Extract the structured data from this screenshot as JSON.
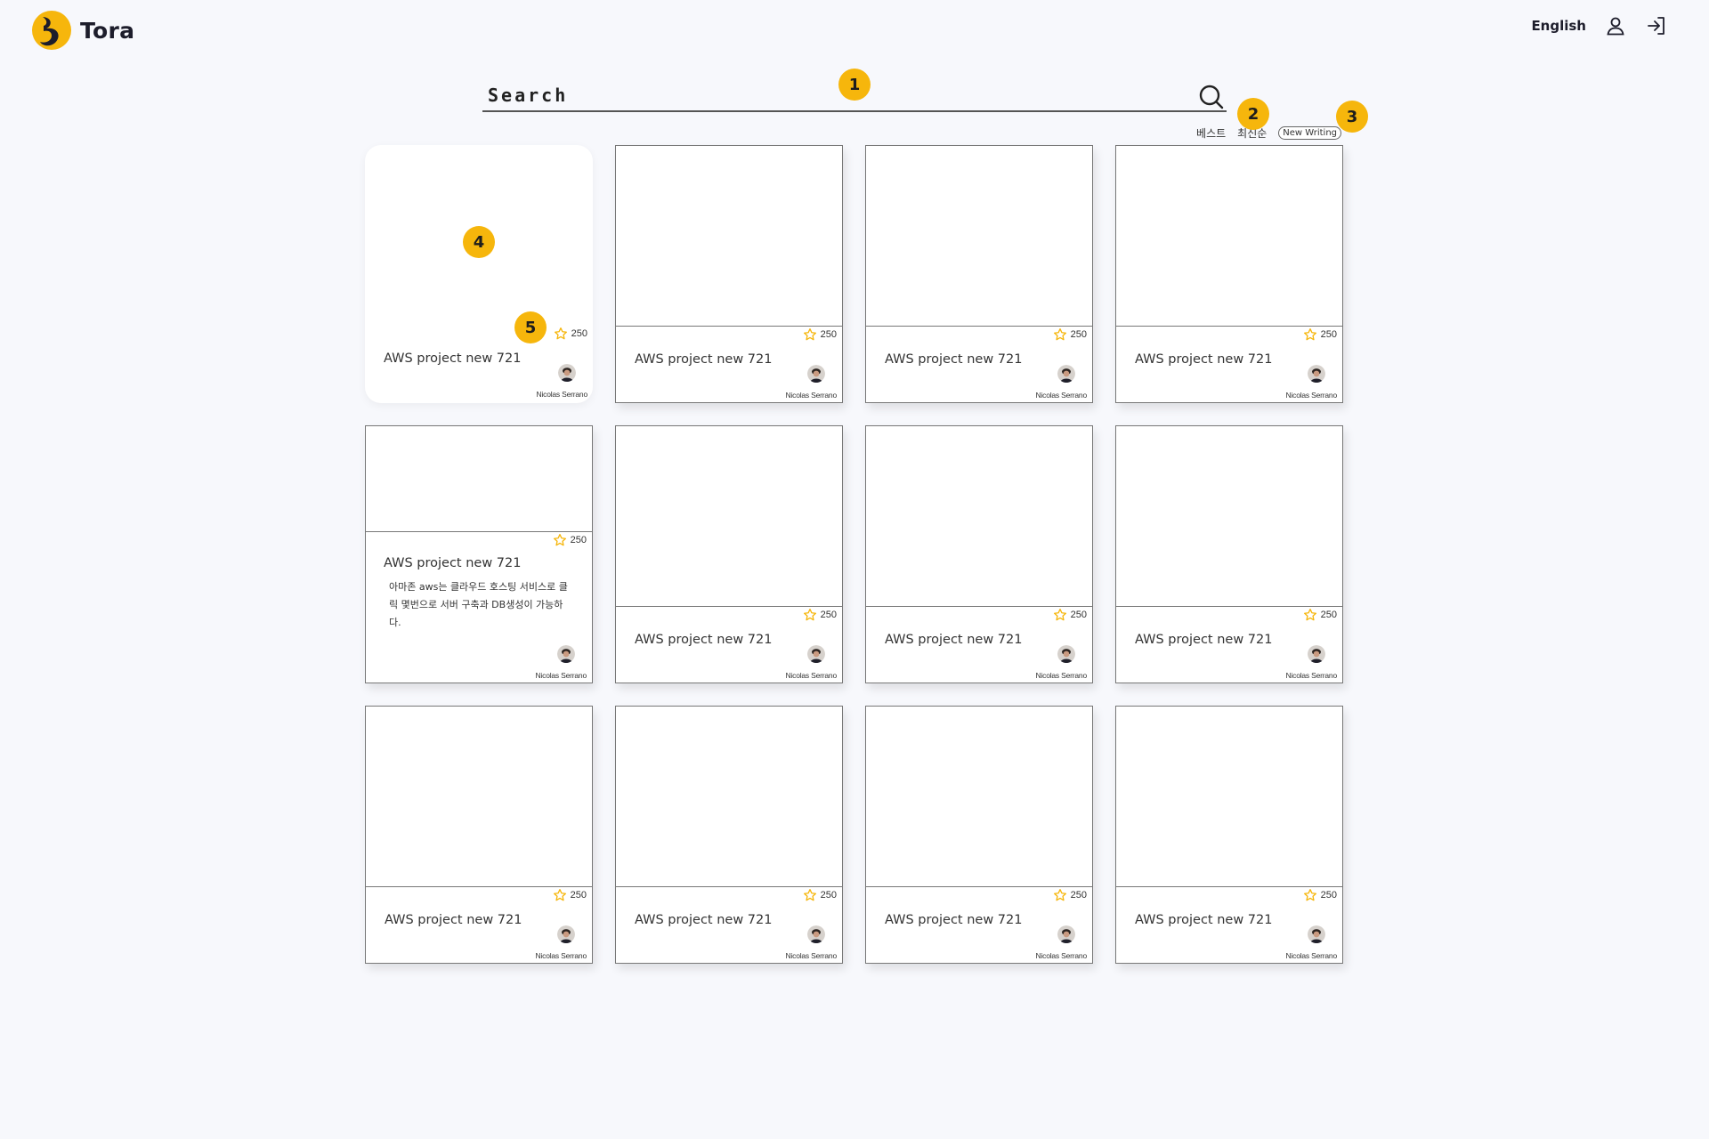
{
  "header": {
    "brand": "Tora",
    "language_label": "English",
    "profile_icon": "user-icon",
    "login_icon": "sign-in-icon"
  },
  "search": {
    "placeholder": "Search",
    "value": "",
    "icon": "search-icon"
  },
  "sort": {
    "tabs": [
      {
        "label": "베스트"
      },
      {
        "label": "최신순"
      }
    ],
    "new_writing_label": "New Writing"
  },
  "callouts": [
    "1",
    "2",
    "3",
    "4",
    "5"
  ],
  "colors": {
    "accent": "#f6b60c",
    "star": "#f6b60c",
    "background": "#f7f8fc",
    "card_border": "#777777"
  },
  "cards": [
    {
      "title": "AWS project new 721",
      "rating": "250",
      "author": "Nicolas Serrano",
      "description": ""
    },
    {
      "title": "AWS project new 721",
      "rating": "250",
      "author": "Nicolas Serrano",
      "description": ""
    },
    {
      "title": "AWS project new 721",
      "rating": "250",
      "author": "Nicolas Serrano",
      "description": ""
    },
    {
      "title": "AWS project new 721",
      "rating": "250",
      "author": "Nicolas Serrano",
      "description": ""
    },
    {
      "title": "AWS project new 721",
      "rating": "250",
      "author": "Nicolas Serrano",
      "description": "아마존 aws는 클라우드 호스팅 서비스로 클릭 몇번으로 서버 구축과 DB생성이 가능하다."
    },
    {
      "title": "AWS project new 721",
      "rating": "250",
      "author": "Nicolas Serrano",
      "description": ""
    },
    {
      "title": "AWS project new 721",
      "rating": "250",
      "author": "Nicolas Serrano",
      "description": ""
    },
    {
      "title": "AWS project new 721",
      "rating": "250",
      "author": "Nicolas Serrano",
      "description": ""
    },
    {
      "title": "AWS project new 721",
      "rating": "250",
      "author": "Nicolas Serrano",
      "description": ""
    },
    {
      "title": "AWS project new 721",
      "rating": "250",
      "author": "Nicolas Serrano",
      "description": ""
    },
    {
      "title": "AWS project new 721",
      "rating": "250",
      "author": "Nicolas Serrano",
      "description": ""
    },
    {
      "title": "AWS project new 721",
      "rating": "250",
      "author": "Nicolas Serrano",
      "description": ""
    }
  ]
}
